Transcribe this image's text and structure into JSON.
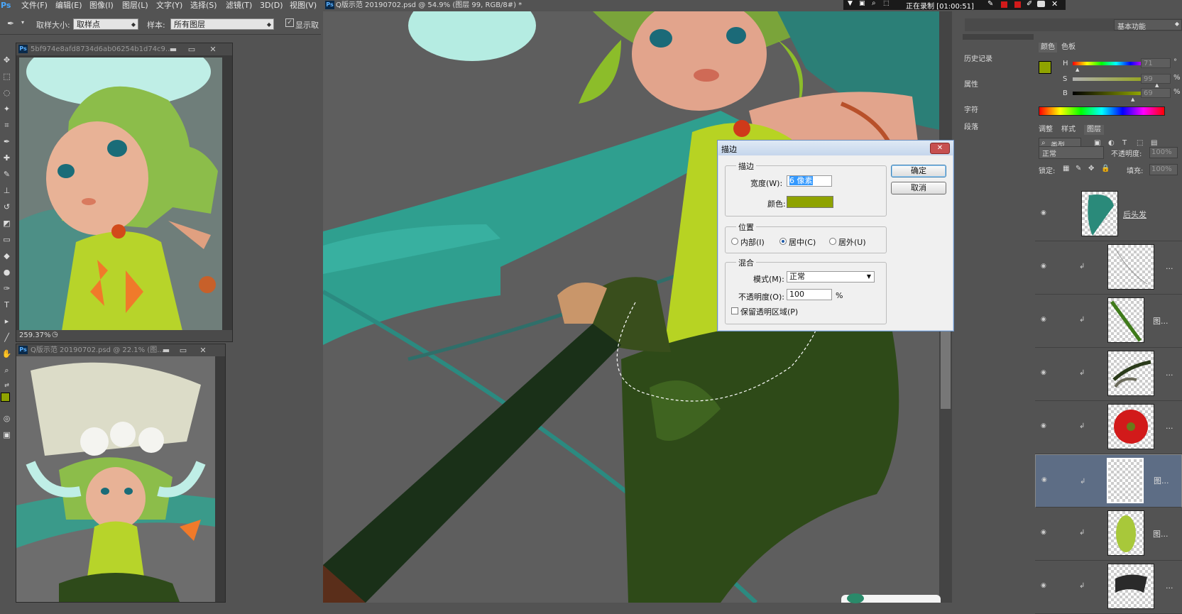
{
  "menu": {
    "ps_logo": "Ps",
    "items": [
      "文件(F)",
      "编辑(E)",
      "图像(I)",
      "图层(L)",
      "文字(Y)",
      "选择(S)",
      "滤镜(T)",
      "3D(D)",
      "视图(V)"
    ]
  },
  "recording": {
    "label": "正在录制 [01:00:51]"
  },
  "options_bar": {
    "sample_size_label": "取样大小:",
    "sample_size_value": "取样点",
    "sample_label": "样本:",
    "sample_value": "所有图层",
    "show_ring_label": "显示取"
  },
  "workspace": {
    "label": "基本功能"
  },
  "doc1": {
    "title": "5bf974e8afd8734d6ab06254b1d74c9...",
    "zoom": "259.37%"
  },
  "doc2": {
    "title": "Q版示范 20190702.psd @ 22.1% (图..."
  },
  "main_doc": {
    "title": "Q版示范 20190702.psd @ 54.9% (图层 99, RGB/8#) *"
  },
  "collapsed_panels": [
    "历史记录",
    "属性",
    "字符",
    "段落"
  ],
  "color_panel": {
    "tabs": [
      "颜色",
      "色板"
    ],
    "h_label": "H",
    "h_value": "71",
    "h_unit": "°",
    "s_label": "S",
    "s_value": "99",
    "s_unit": "%",
    "b_label": "B",
    "b_value": "69",
    "b_unit": "%",
    "foreground": "#8fa300",
    "background": "#ffffff"
  },
  "layers_panel": {
    "tabs": [
      "调整",
      "样式",
      "图层"
    ],
    "filter_label": "类型",
    "blend_mode": "正常",
    "opacity_label": "不透明度:",
    "opacity_value": "100%",
    "lock_label": "锁定:",
    "fill_label": "填充:",
    "fill_value": "100%",
    "layers": [
      {
        "name": "后头发"
      },
      {
        "name": "..."
      },
      {
        "name": "图..."
      },
      {
        "name": "..."
      },
      {
        "name": "..."
      },
      {
        "name": "图..."
      },
      {
        "name": "图..."
      },
      {
        "name": "..."
      }
    ]
  },
  "dialog": {
    "title": "描边",
    "close": "✕",
    "stroke_group": "描边",
    "width_label": "宽度(W):",
    "width_value": "6 像素",
    "color_label": "颜色:",
    "stroke_color": "#8fa300",
    "position_group": "位置",
    "pos_inside": "内部(I)",
    "pos_center": "居中(C)",
    "pos_outside": "居外(U)",
    "blend_group": "混合",
    "mode_label": "模式(M):",
    "mode_value": "正常",
    "opacity_label": "不透明度(O):",
    "opacity_value": "100",
    "opacity_unit": "%",
    "preserve_label": "保留透明区域(P)",
    "ok": "确定",
    "cancel": "取消"
  }
}
